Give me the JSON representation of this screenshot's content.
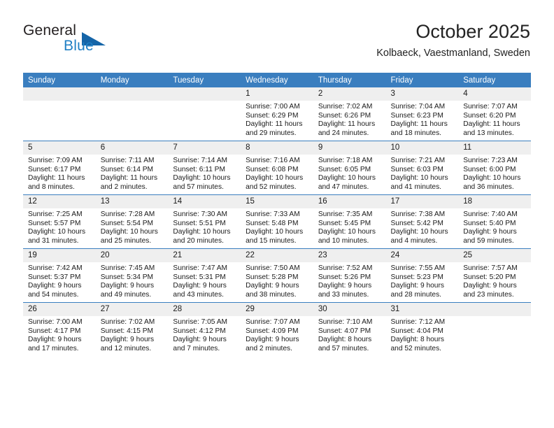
{
  "logo": {
    "word_top": "General",
    "word_bottom": "Blue",
    "triangle_color": "#1565a8",
    "blue_color": "#1f7fc4"
  },
  "header": {
    "title": "October 2025",
    "subtitle": "Kolbaeck, Vaestmanland, Sweden"
  },
  "theme": {
    "header_blue": "#3a7ebf",
    "daynum_gray": "#efefef",
    "text": "#1a1a1a"
  },
  "weekdays": [
    "Sunday",
    "Monday",
    "Tuesday",
    "Wednesday",
    "Thursday",
    "Friday",
    "Saturday"
  ],
  "labels": {
    "sunrise": "Sunrise:",
    "sunset": "Sunset:",
    "daylight": "Daylight:"
  },
  "weeks": [
    [
      {
        "day": "",
        "empty": true
      },
      {
        "day": "",
        "empty": true
      },
      {
        "day": "",
        "empty": true
      },
      {
        "day": "1",
        "sunrise": "Sunrise: 7:00 AM",
        "sunset": "Sunset: 6:29 PM",
        "daylight": "Daylight: 11 hours and 29 minutes."
      },
      {
        "day": "2",
        "sunrise": "Sunrise: 7:02 AM",
        "sunset": "Sunset: 6:26 PM",
        "daylight": "Daylight: 11 hours and 24 minutes."
      },
      {
        "day": "3",
        "sunrise": "Sunrise: 7:04 AM",
        "sunset": "Sunset: 6:23 PM",
        "daylight": "Daylight: 11 hours and 18 minutes."
      },
      {
        "day": "4",
        "sunrise": "Sunrise: 7:07 AM",
        "sunset": "Sunset: 6:20 PM",
        "daylight": "Daylight: 11 hours and 13 minutes."
      }
    ],
    [
      {
        "day": "5",
        "sunrise": "Sunrise: 7:09 AM",
        "sunset": "Sunset: 6:17 PM",
        "daylight": "Daylight: 11 hours and 8 minutes."
      },
      {
        "day": "6",
        "sunrise": "Sunrise: 7:11 AM",
        "sunset": "Sunset: 6:14 PM",
        "daylight": "Daylight: 11 hours and 2 minutes."
      },
      {
        "day": "7",
        "sunrise": "Sunrise: 7:14 AM",
        "sunset": "Sunset: 6:11 PM",
        "daylight": "Daylight: 10 hours and 57 minutes."
      },
      {
        "day": "8",
        "sunrise": "Sunrise: 7:16 AM",
        "sunset": "Sunset: 6:08 PM",
        "daylight": "Daylight: 10 hours and 52 minutes."
      },
      {
        "day": "9",
        "sunrise": "Sunrise: 7:18 AM",
        "sunset": "Sunset: 6:05 PM",
        "daylight": "Daylight: 10 hours and 47 minutes."
      },
      {
        "day": "10",
        "sunrise": "Sunrise: 7:21 AM",
        "sunset": "Sunset: 6:03 PM",
        "daylight": "Daylight: 10 hours and 41 minutes."
      },
      {
        "day": "11",
        "sunrise": "Sunrise: 7:23 AM",
        "sunset": "Sunset: 6:00 PM",
        "daylight": "Daylight: 10 hours and 36 minutes."
      }
    ],
    [
      {
        "day": "12",
        "sunrise": "Sunrise: 7:25 AM",
        "sunset": "Sunset: 5:57 PM",
        "daylight": "Daylight: 10 hours and 31 minutes."
      },
      {
        "day": "13",
        "sunrise": "Sunrise: 7:28 AM",
        "sunset": "Sunset: 5:54 PM",
        "daylight": "Daylight: 10 hours and 25 minutes."
      },
      {
        "day": "14",
        "sunrise": "Sunrise: 7:30 AM",
        "sunset": "Sunset: 5:51 PM",
        "daylight": "Daylight: 10 hours and 20 minutes."
      },
      {
        "day": "15",
        "sunrise": "Sunrise: 7:33 AM",
        "sunset": "Sunset: 5:48 PM",
        "daylight": "Daylight: 10 hours and 15 minutes."
      },
      {
        "day": "16",
        "sunrise": "Sunrise: 7:35 AM",
        "sunset": "Sunset: 5:45 PM",
        "daylight": "Daylight: 10 hours and 10 minutes."
      },
      {
        "day": "17",
        "sunrise": "Sunrise: 7:38 AM",
        "sunset": "Sunset: 5:42 PM",
        "daylight": "Daylight: 10 hours and 4 minutes."
      },
      {
        "day": "18",
        "sunrise": "Sunrise: 7:40 AM",
        "sunset": "Sunset: 5:40 PM",
        "daylight": "Daylight: 9 hours and 59 minutes."
      }
    ],
    [
      {
        "day": "19",
        "sunrise": "Sunrise: 7:42 AM",
        "sunset": "Sunset: 5:37 PM",
        "daylight": "Daylight: 9 hours and 54 minutes."
      },
      {
        "day": "20",
        "sunrise": "Sunrise: 7:45 AM",
        "sunset": "Sunset: 5:34 PM",
        "daylight": "Daylight: 9 hours and 49 minutes."
      },
      {
        "day": "21",
        "sunrise": "Sunrise: 7:47 AM",
        "sunset": "Sunset: 5:31 PM",
        "daylight": "Daylight: 9 hours and 43 minutes."
      },
      {
        "day": "22",
        "sunrise": "Sunrise: 7:50 AM",
        "sunset": "Sunset: 5:28 PM",
        "daylight": "Daylight: 9 hours and 38 minutes."
      },
      {
        "day": "23",
        "sunrise": "Sunrise: 7:52 AM",
        "sunset": "Sunset: 5:26 PM",
        "daylight": "Daylight: 9 hours and 33 minutes."
      },
      {
        "day": "24",
        "sunrise": "Sunrise: 7:55 AM",
        "sunset": "Sunset: 5:23 PM",
        "daylight": "Daylight: 9 hours and 28 minutes."
      },
      {
        "day": "25",
        "sunrise": "Sunrise: 7:57 AM",
        "sunset": "Sunset: 5:20 PM",
        "daylight": "Daylight: 9 hours and 23 minutes."
      }
    ],
    [
      {
        "day": "26",
        "sunrise": "Sunrise: 7:00 AM",
        "sunset": "Sunset: 4:17 PM",
        "daylight": "Daylight: 9 hours and 17 minutes."
      },
      {
        "day": "27",
        "sunrise": "Sunrise: 7:02 AM",
        "sunset": "Sunset: 4:15 PM",
        "daylight": "Daylight: 9 hours and 12 minutes."
      },
      {
        "day": "28",
        "sunrise": "Sunrise: 7:05 AM",
        "sunset": "Sunset: 4:12 PM",
        "daylight": "Daylight: 9 hours and 7 minutes."
      },
      {
        "day": "29",
        "sunrise": "Sunrise: 7:07 AM",
        "sunset": "Sunset: 4:09 PM",
        "daylight": "Daylight: 9 hours and 2 minutes."
      },
      {
        "day": "30",
        "sunrise": "Sunrise: 7:10 AM",
        "sunset": "Sunset: 4:07 PM",
        "daylight": "Daylight: 8 hours and 57 minutes."
      },
      {
        "day": "31",
        "sunrise": "Sunrise: 7:12 AM",
        "sunset": "Sunset: 4:04 PM",
        "daylight": "Daylight: 8 hours and 52 minutes."
      },
      {
        "day": "",
        "empty": true
      }
    ]
  ]
}
